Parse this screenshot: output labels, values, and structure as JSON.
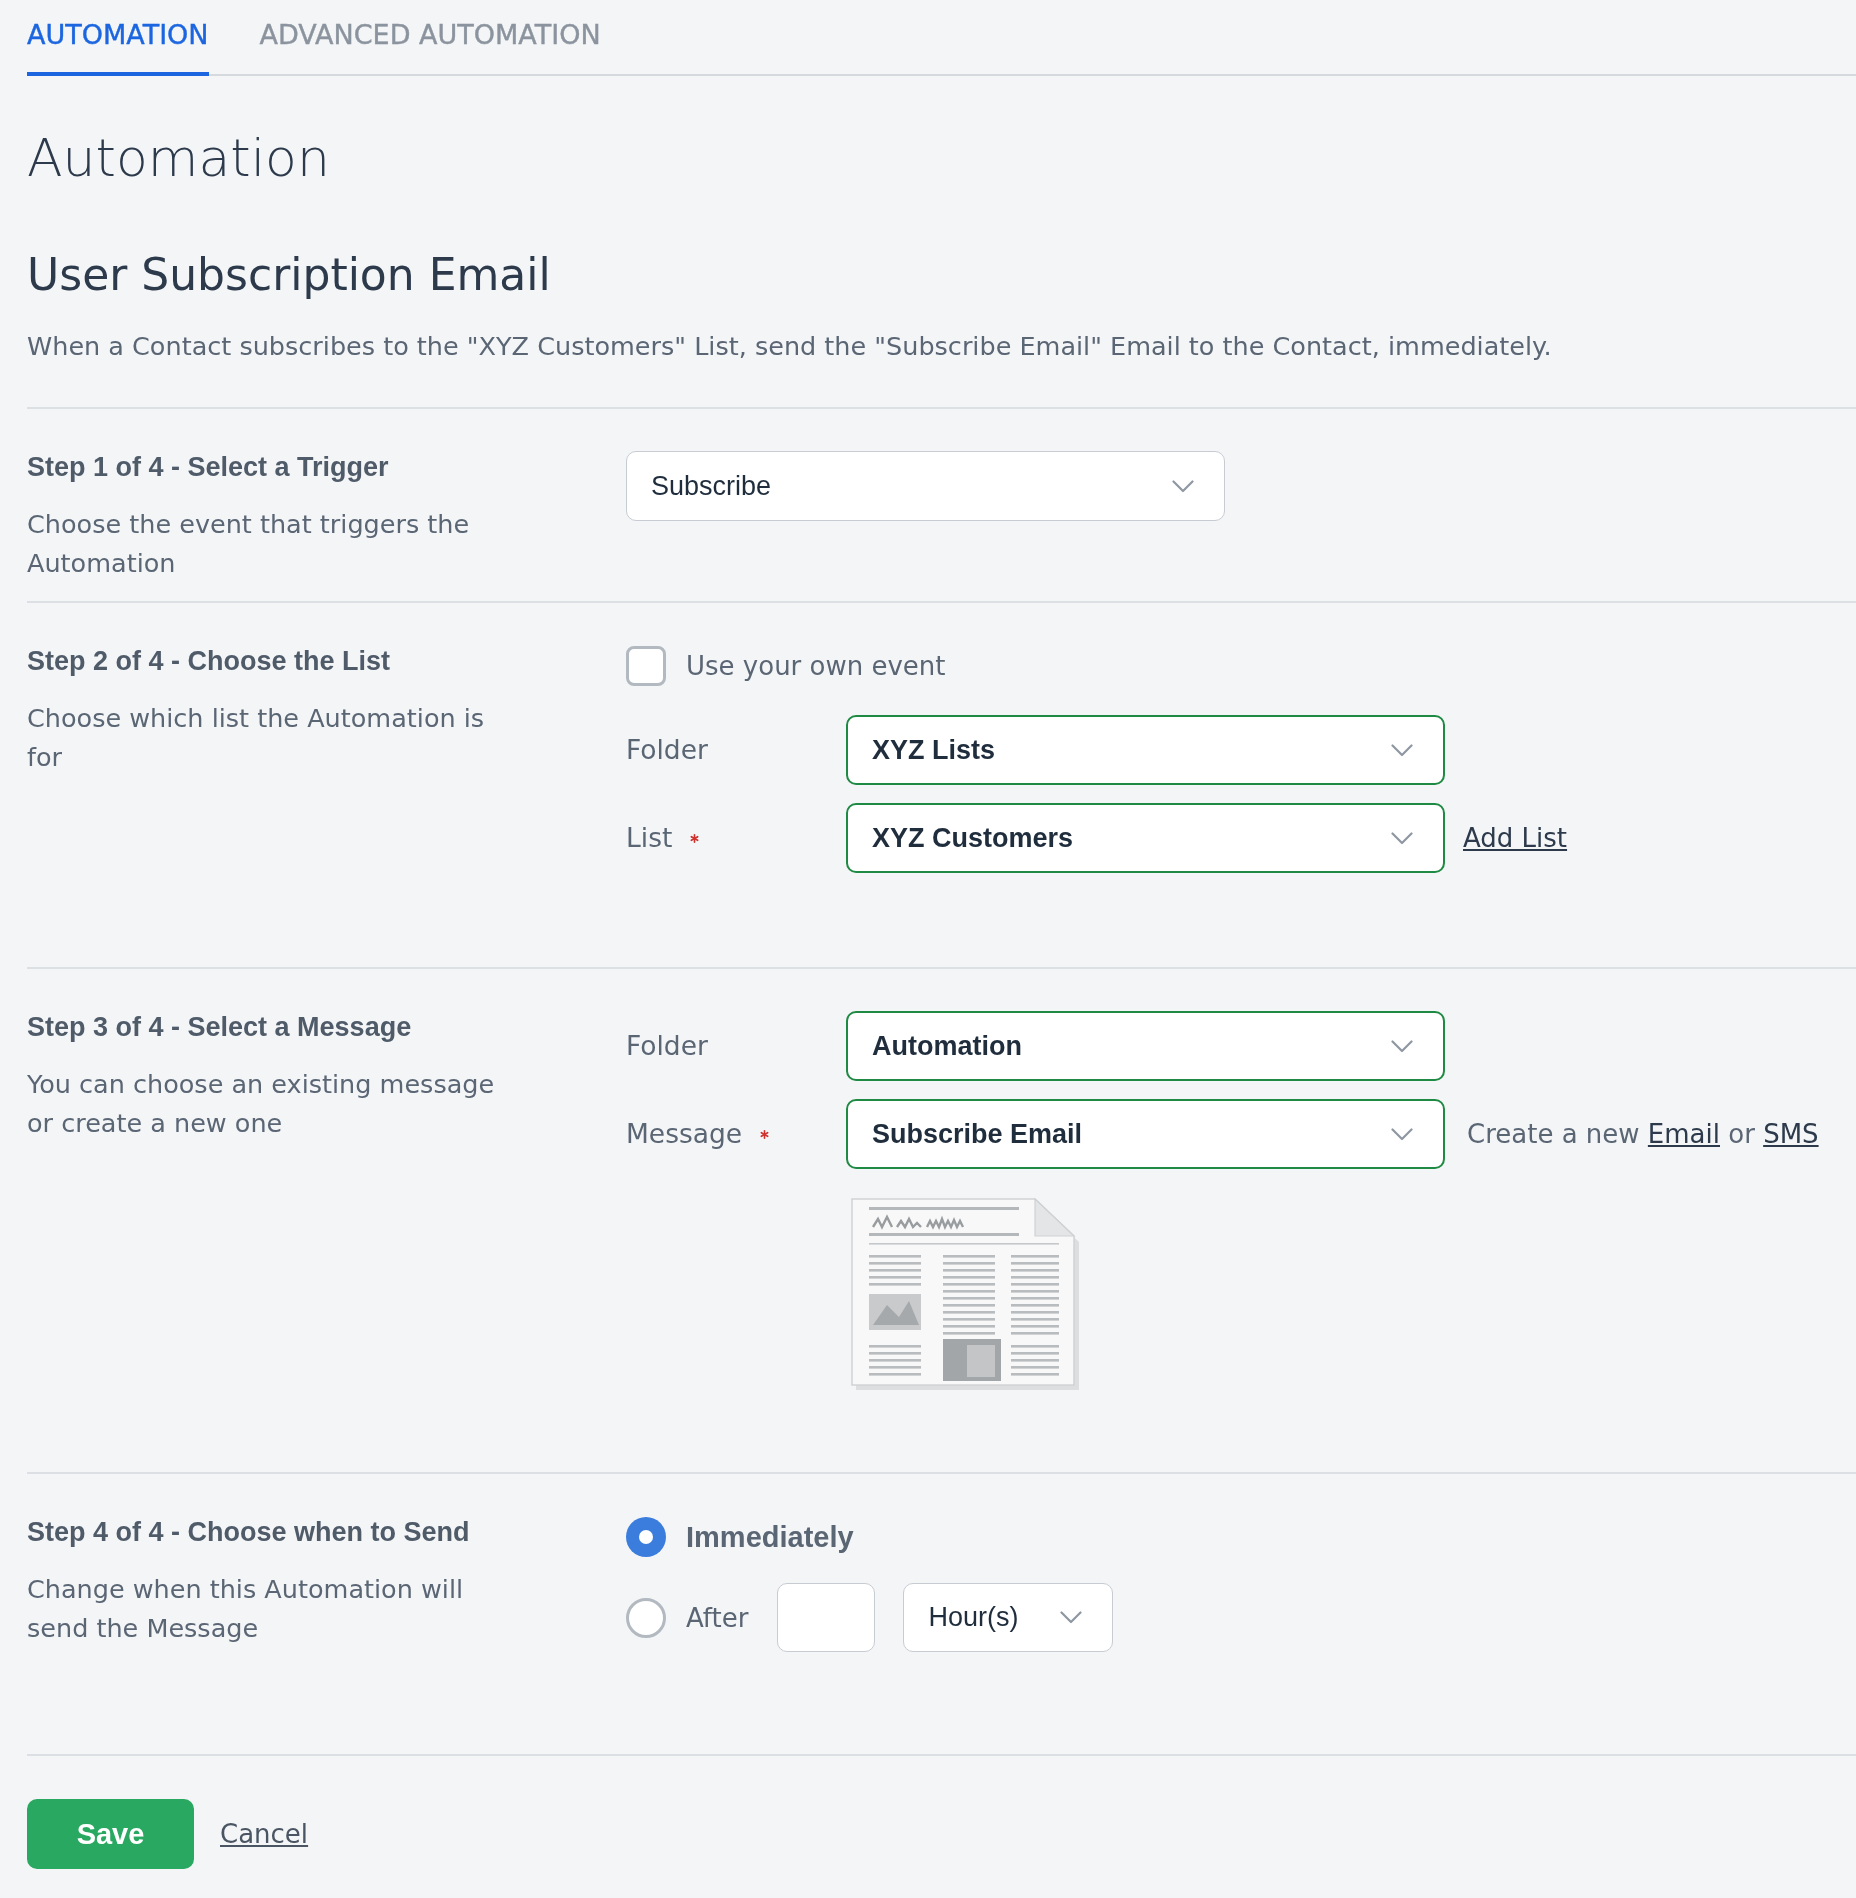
{
  "tabs": [
    {
      "label": "AUTOMATION",
      "selected": true
    },
    {
      "label": "ADVANCED AUTOMATION",
      "selected": false
    }
  ],
  "page_title": "Automation",
  "automation": {
    "name": "User Subscription Email",
    "summary": "When a Contact subscribes to the \"XYZ Customers\" List, send the \"Subscribe Email\" Email to the Contact, immediately."
  },
  "steps": [
    {
      "title": "Step 1 of 4 - Select a Trigger",
      "description": "Choose the event that triggers the Automation",
      "rows": [
        {
          "kind": "select",
          "value": "Subscribe",
          "valid": false
        }
      ]
    },
    {
      "title": "Step 2 of 4 - Choose the List",
      "description": "Choose which list the Automation is for",
      "rows": [
        {
          "kind": "checkbox",
          "label": "Use your own event",
          "checked": false
        },
        {
          "kind": "select",
          "label": "Folder",
          "value": "XYZ Lists",
          "valid": true
        },
        {
          "kind": "select",
          "label": "List",
          "required": true,
          "value": "XYZ Customers",
          "valid": true,
          "aside": [
            {
              "kind": "link",
              "text": "Add List"
            }
          ]
        }
      ]
    },
    {
      "title": "Step 3 of 4 - Select a Message",
      "description": "You can choose an existing message or create a new one",
      "rows": [
        {
          "kind": "select",
          "label": "Folder",
          "value": "Automation",
          "valid": true
        },
        {
          "kind": "select",
          "label": "Message",
          "required": true,
          "value": "Subscribe Email",
          "valid": true,
          "aside": [
            {
              "kind": "text",
              "text": "Create a new"
            },
            {
              "kind": "link",
              "text": "Email"
            },
            {
              "kind": "text",
              "text": "or"
            },
            {
              "kind": "link",
              "text": "SMS"
            }
          ]
        },
        {
          "kind": "preview"
        }
      ]
    },
    {
      "title": "Step 4 of 4 - Choose when to Send",
      "description": "Change when this Automation will send the Message",
      "rows": [
        {
          "kind": "radio",
          "label": "Immediately",
          "selected": true
        },
        {
          "kind": "radio",
          "label": "After",
          "selected": false,
          "delay": {
            "unit": "Hour(s)"
          }
        }
      ]
    }
  ],
  "actions": [
    {
      "kind": "primary",
      "label": "Save"
    },
    {
      "kind": "link",
      "label": "Cancel"
    }
  ]
}
